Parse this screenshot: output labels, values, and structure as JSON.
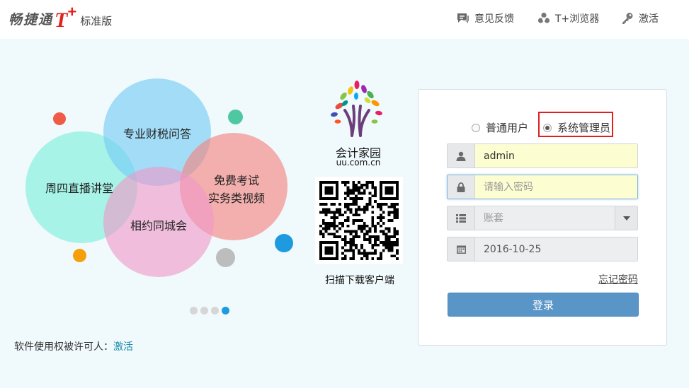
{
  "header": {
    "logo_cn": "畅捷通",
    "logo_t": "T",
    "logo_plus": "+",
    "logo_edition": "标准版",
    "nav": [
      {
        "label": "意见反馈",
        "icon": "feedback-icon"
      },
      {
        "label": "T+浏览器",
        "icon": "browser-icon"
      },
      {
        "label": "激活",
        "icon": "key-icon"
      }
    ]
  },
  "slide": {
    "bubbles": [
      "专业财税问答",
      "周四直播讲堂",
      "免费考试",
      "实务类视频",
      "相约同城会"
    ],
    "active_page": 4,
    "page_count": 4
  },
  "license": {
    "label": "软件使用权被许可人：",
    "link": "激活"
  },
  "promo": {
    "site_name": "会计家园",
    "site_url": "uu.com.cn",
    "qr_caption": "扫描下载客户端"
  },
  "login": {
    "roles": [
      {
        "label": "普通用户",
        "selected": false
      },
      {
        "label": "系统管理员",
        "selected": true
      }
    ],
    "username": "admin",
    "password_placeholder": "请输入密码",
    "account_placeholder": "账套",
    "date": "2016-10-25",
    "forgot": "忘记密码",
    "submit": "登录"
  },
  "colors": {
    "accent": "#5a95c8",
    "highlight": "#e02020",
    "brand_red": "#e2211c"
  }
}
